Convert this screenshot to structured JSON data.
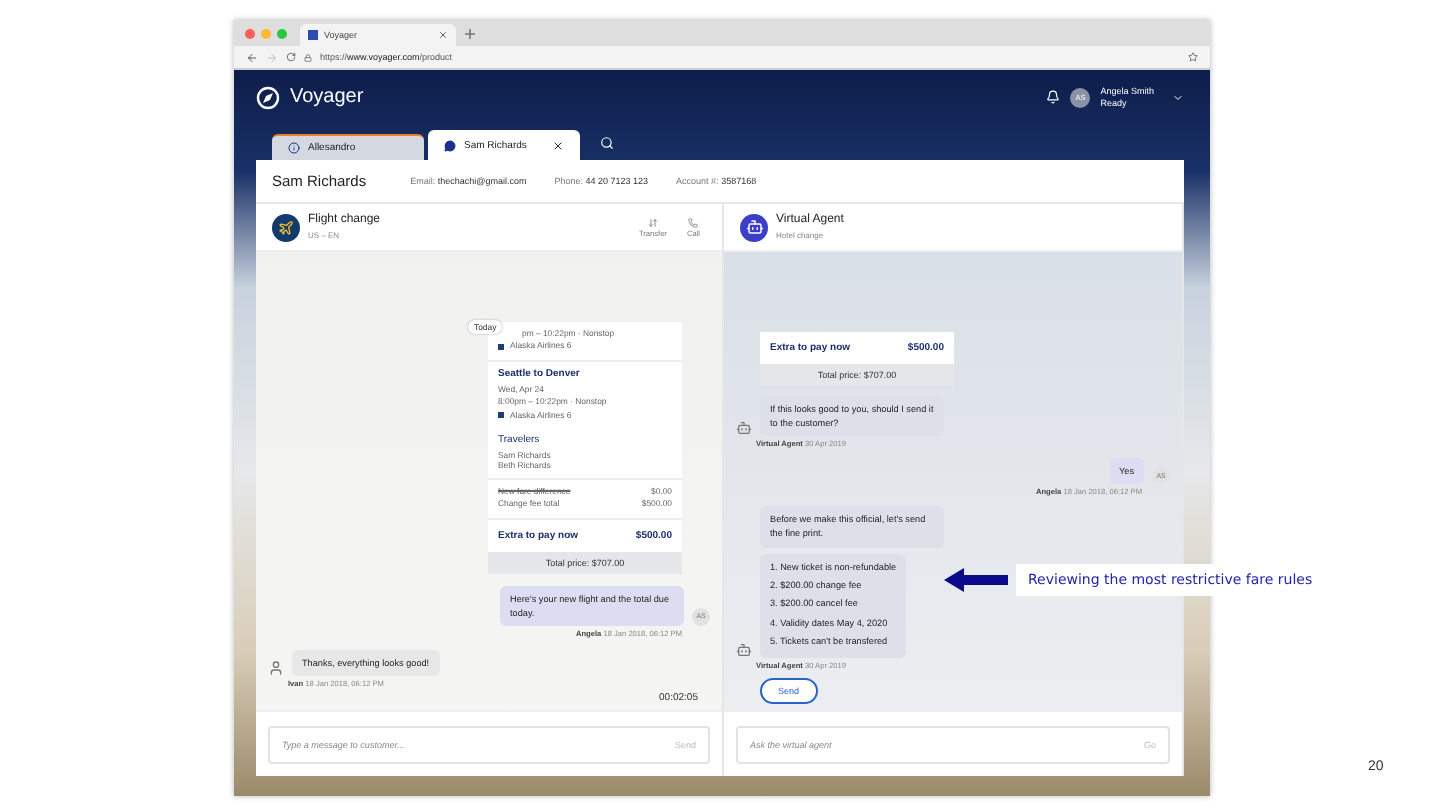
{
  "browser": {
    "tab_title": "Voyager",
    "url_scheme": "https://",
    "url_host": "www.voyager.com",
    "url_path": "/product"
  },
  "app": {
    "logo": "Voyager",
    "user": {
      "initials": "AS",
      "name": "Angela Smith",
      "status": "Ready"
    },
    "tabs": [
      {
        "label": "Allesandro",
        "selected": false,
        "kind": "alert"
      },
      {
        "label": "Sam Richards",
        "selected": true,
        "kind": "chat"
      }
    ]
  },
  "customer": {
    "name": "Sam Richards",
    "fields": [
      {
        "label": "Email:",
        "value": "thechachi@gmail.com"
      },
      {
        "label": "Phone:",
        "value": "44 20 7123 123"
      },
      {
        "label": "Account #:",
        "value": "3587168"
      }
    ]
  },
  "left_panel": {
    "title": "Flight change",
    "subtitle": "US – EN",
    "actions": [
      {
        "label": "Transfer",
        "kind": "transfer"
      },
      {
        "label": "Call",
        "kind": "call"
      }
    ],
    "date_pill": "Today",
    "itinerary": {
      "top_line": "pm – 10:22pm · Nonstop",
      "top_airline": "Alaska Airlines 6",
      "segments": [
        {
          "route": "Seattle to Denver",
          "date": "Wed, Apr 24",
          "time": "8:00pm – 10:22pm · Nonstop",
          "airline": "Alaska Airlines 6"
        }
      ],
      "travelers_title": "Travelers",
      "travelers": [
        "Sam Richards",
        "Beth Richards"
      ],
      "fees": [
        {
          "label": "New fare difference",
          "value": "$0.00",
          "struck": true
        },
        {
          "label": "Change fee total",
          "value": "$500.00",
          "struck": false
        }
      ],
      "extra_label": "Extra to pay now",
      "extra_value": "$500.00",
      "total": "Total price: $707.00"
    },
    "messages": [
      {
        "kind": "agent",
        "text": "Here's your new flight and the total due today.",
        "avatar": "AS",
        "sender": "Angela",
        "time": "18 Jan 2018, 06:12 PM"
      },
      {
        "kind": "customer",
        "text": "Thanks, everything looks good!",
        "sender": "Ivan",
        "time": "18 Jan 2018, 06:12 PM"
      }
    ],
    "timer": "00:02:05",
    "input_placeholder": "Type a message to customer...",
    "send": "Send"
  },
  "right_panel": {
    "title": "Virtual Agent",
    "subtitle": "Hotel change",
    "card": {
      "extra_label": "Extra to pay now",
      "extra_value": "$500.00",
      "total": "Total price: $707.00"
    },
    "messages": [
      {
        "kind": "bot",
        "bubbles": [
          "If this looks good to you, should I send it to the customer?"
        ],
        "sender": "Virtual Agent",
        "time": "30 Apr 2019"
      },
      {
        "kind": "agent",
        "bubbles": [
          "Yes"
        ],
        "avatar": "AS",
        "sender": "Angela",
        "time": "18 Jan 2018, 06:12 PM"
      },
      {
        "kind": "bot",
        "bubbles": [
          "Before we make this official, let's send the fine print."
        ],
        "list": [
          "1. New ticket is non-refundable",
          "2. $200.00 change fee",
          "3. $200.00 cancel fee",
          "4. Validity dates May 4, 2020",
          "5. Tickets can't be transfered"
        ],
        "sender": "Virtual Agent",
        "time": "30 Apr 2019"
      }
    ],
    "action_button": "Send",
    "input_placeholder": "Ask the virtual agent",
    "send": "Go"
  },
  "annotation": "Reviewing the most restrictive fare rules",
  "page_number": "20"
}
